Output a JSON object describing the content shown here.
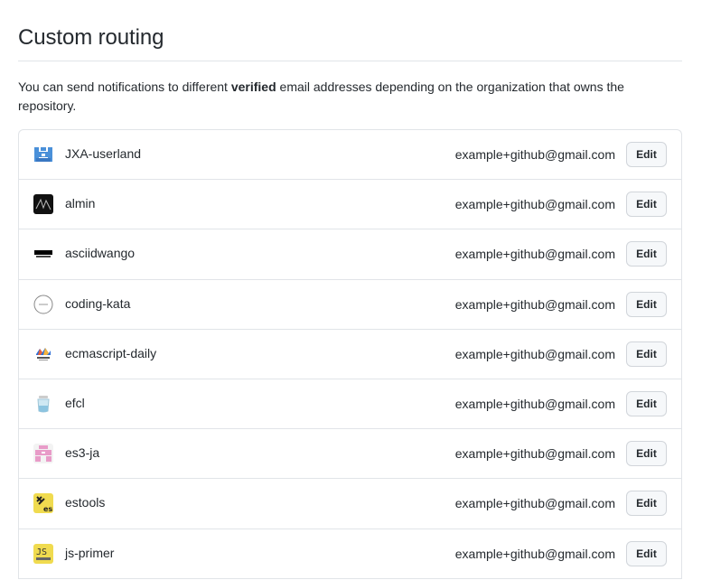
{
  "page": {
    "title": "Custom routing",
    "description_prefix": "You can send notifications to different ",
    "description_bold": "verified",
    "description_suffix": " email addresses depending on the organization that owns the repository."
  },
  "routing": {
    "edit_label": "Edit",
    "rows": [
      {
        "org": "JXA-userland",
        "email": "example+github@gmail.com",
        "avatar_icon": "jxa-userland-logo-icon",
        "avatar_color": "#4a90d9"
      },
      {
        "org": "almin",
        "email": "example+github@gmail.com",
        "avatar_icon": "almin-logo-icon",
        "avatar_color": "#111111"
      },
      {
        "org": "asciidwango",
        "email": "example+github@gmail.com",
        "avatar_icon": "ascii-logo-icon",
        "avatar_color": "#000000"
      },
      {
        "org": "coding-kata",
        "email": "example+github@gmail.com",
        "avatar_icon": "coding-kata-logo-icon",
        "avatar_color": "#888888"
      },
      {
        "org": "ecmascript-daily",
        "email": "example+github@gmail.com",
        "avatar_icon": "es-daily-logo-icon",
        "avatar_color": "#2f6fd6"
      },
      {
        "org": "efcl",
        "email": "example+github@gmail.com",
        "avatar_icon": "efcl-logo-icon",
        "avatar_color": "#9fd0e8"
      },
      {
        "org": "es3-ja",
        "email": "example+github@gmail.com",
        "avatar_icon": "es3-ja-logo-icon",
        "avatar_color": "#e89bc8"
      },
      {
        "org": "estools",
        "email": "example+github@gmail.com",
        "avatar_icon": "estools-logo-icon",
        "avatar_color": "#f0db4f"
      },
      {
        "org": "js-primer",
        "email": "example+github@gmail.com",
        "avatar_icon": "js-primer-logo-icon",
        "avatar_color": "#f0db4f"
      }
    ]
  }
}
